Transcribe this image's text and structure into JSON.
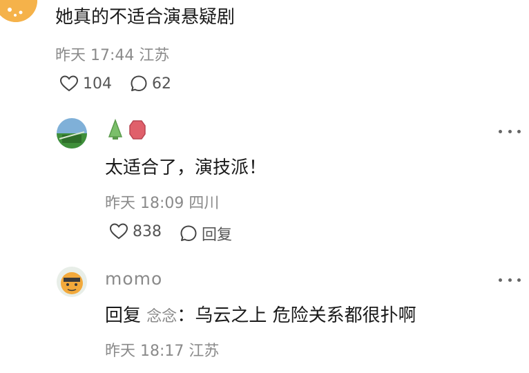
{
  "comments": [
    {
      "text": "她真的不适合演悬疑剧",
      "time": "昨天 17:44",
      "location": "江苏",
      "likes": "104",
      "replies": "62"
    }
  ],
  "replies": [
    {
      "text": "太适合了，演技派！",
      "time": "昨天 18:09",
      "location": "四川",
      "likes": "838",
      "reply_label": "回复"
    },
    {
      "username": "momo",
      "reply_prefix": "回复",
      "reply_target": "念念",
      "reply_sep": "：",
      "text": "乌云之上 危险关系都很扑啊",
      "time": "昨天 18:17",
      "location": "江苏"
    }
  ],
  "colors": {
    "meta": "#8a8a8a",
    "badge_green": "#7bbf6a",
    "badge_red": "#e0606b",
    "avatar_orange": "#f2a93b"
  }
}
